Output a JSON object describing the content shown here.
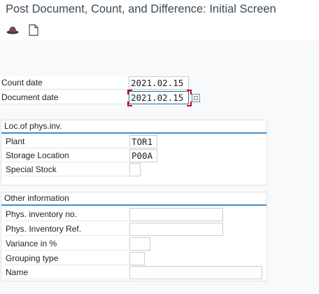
{
  "window": {
    "title": "Post Document, Count, and Difference: Initial Screen"
  },
  "toolbar": {
    "buttons": [
      {
        "icon": "hat-icon",
        "name": "held-data"
      },
      {
        "icon": "document-icon",
        "name": "new-document"
      }
    ]
  },
  "header_fields": {
    "count_date": {
      "label": "Count date",
      "value": "2021.02.15"
    },
    "document_date": {
      "label": "Document date",
      "value": "2021.02.15"
    }
  },
  "loc_group": {
    "title": "Loc.of phys.inv.",
    "fields": {
      "plant": {
        "label": "Plant",
        "value": "TOR1"
      },
      "storage_location": {
        "label": "Storage Location",
        "value": "P00A"
      },
      "special_stock": {
        "label": "Special Stock",
        "value": ""
      }
    }
  },
  "other_group": {
    "title": "Other information",
    "fields": {
      "phys_inventory_no": {
        "label": "Phys. inventory no.",
        "value": ""
      },
      "phys_inventory_ref": {
        "label": "Phys. Inventory Ref.",
        "value": ""
      },
      "variance": {
        "label": "Variance in %",
        "value": ""
      },
      "grouping_type": {
        "label": "Grouping type",
        "value": ""
      },
      "name": {
        "label": "Name",
        "value": ""
      }
    }
  },
  "colors": {
    "accent": "#3c8fc9",
    "focus_corner": "#d0021b",
    "title_text": "#3b4a57"
  }
}
